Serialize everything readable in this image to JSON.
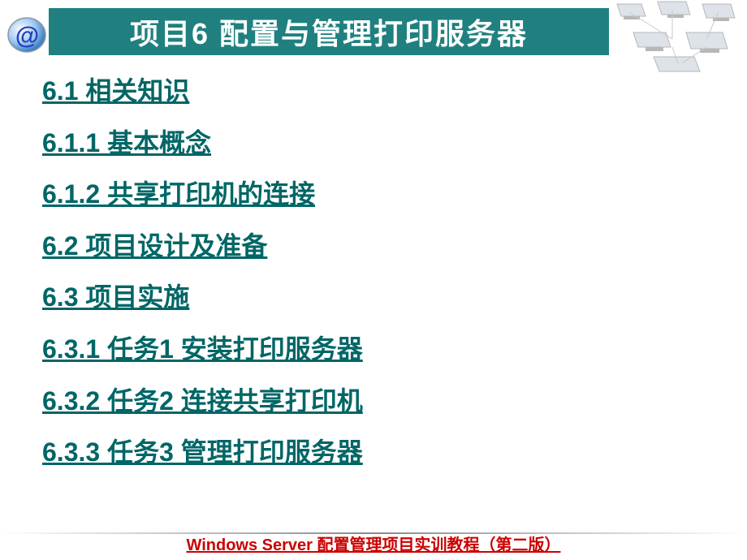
{
  "title": "项目6  配置与管理打印服务器",
  "toc": [
    "6.1  相关知识",
    "6.1.1  基本概念",
    "6.1.2  共享打印机的连接",
    "6.2  项目设计及准备",
    "6.3  项目实施",
    "6.3.1  任务1 安装打印服务器",
    "6.3.2  任务2 连接共享打印机",
    "6.3.3  任务3 管理打印服务器"
  ],
  "footer": "Windows Server 配置管理项目实训教程（第二版）"
}
